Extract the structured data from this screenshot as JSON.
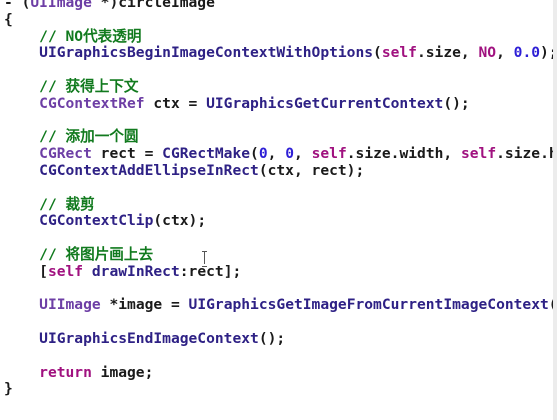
{
  "editor": {
    "lines": [
      [
        {
          "t": "- (",
          "c": "tx"
        },
        {
          "t": "UIImage",
          "c": "ty"
        },
        {
          "t": " *)circleImage",
          "c": "tx"
        }
      ],
      [
        {
          "t": "{",
          "c": "tx"
        }
      ],
      [
        {
          "t": "    ",
          "c": "tx"
        },
        {
          "t": "// NO代表透明",
          "c": "cm"
        }
      ],
      [
        {
          "t": "    ",
          "c": "tx"
        },
        {
          "t": "UIGraphicsBeginImageContextWithOptions",
          "c": "fn"
        },
        {
          "t": "(",
          "c": "tx"
        },
        {
          "t": "self",
          "c": "kw"
        },
        {
          "t": ".size, ",
          "c": "tx"
        },
        {
          "t": "NO",
          "c": "kw"
        },
        {
          "t": ", ",
          "c": "tx"
        },
        {
          "t": "0.0",
          "c": "nu"
        },
        {
          "t": ");",
          "c": "tx"
        }
      ],
      [
        {
          "t": "",
          "c": "tx"
        }
      ],
      [
        {
          "t": "    ",
          "c": "tx"
        },
        {
          "t": "// 获得上下文",
          "c": "cm"
        }
      ],
      [
        {
          "t": "    ",
          "c": "tx"
        },
        {
          "t": "CGContextRef",
          "c": "ty"
        },
        {
          "t": " ctx = ",
          "c": "tx"
        },
        {
          "t": "UIGraphicsGetCurrentContext",
          "c": "fn"
        },
        {
          "t": "();",
          "c": "tx"
        }
      ],
      [
        {
          "t": "",
          "c": "tx"
        }
      ],
      [
        {
          "t": "    ",
          "c": "tx"
        },
        {
          "t": "// 添加一个圆",
          "c": "cm"
        }
      ],
      [
        {
          "t": "    ",
          "c": "tx"
        },
        {
          "t": "CGRect",
          "c": "ty"
        },
        {
          "t": " rect = ",
          "c": "tx"
        },
        {
          "t": "CGRectMake",
          "c": "fn"
        },
        {
          "t": "(",
          "c": "tx"
        },
        {
          "t": "0",
          "c": "nu"
        },
        {
          "t": ", ",
          "c": "tx"
        },
        {
          "t": "0",
          "c": "nu"
        },
        {
          "t": ", ",
          "c": "tx"
        },
        {
          "t": "self",
          "c": "kw"
        },
        {
          "t": ".size.width, ",
          "c": "tx"
        },
        {
          "t": "self",
          "c": "kw"
        },
        {
          "t": ".size.height);",
          "c": "tx"
        }
      ],
      [
        {
          "t": "    ",
          "c": "tx"
        },
        {
          "t": "CGContextAddEllipseInRect",
          "c": "fn"
        },
        {
          "t": "(ctx, rect);",
          "c": "tx"
        }
      ],
      [
        {
          "t": "",
          "c": "tx"
        }
      ],
      [
        {
          "t": "    ",
          "c": "tx"
        },
        {
          "t": "// 裁剪",
          "c": "cm"
        }
      ],
      [
        {
          "t": "    ",
          "c": "tx"
        },
        {
          "t": "CGContextClip",
          "c": "fn"
        },
        {
          "t": "(ctx);",
          "c": "tx"
        }
      ],
      [
        {
          "t": "",
          "c": "tx"
        }
      ],
      [
        {
          "t": "    ",
          "c": "tx"
        },
        {
          "t": "// 将图片画上去",
          "c": "cm"
        }
      ],
      [
        {
          "t": "    [",
          "c": "tx"
        },
        {
          "t": "self",
          "c": "kw"
        },
        {
          "t": " ",
          "c": "tx"
        },
        {
          "t": "drawInRect",
          "c": "fn"
        },
        {
          "t": ":rect];",
          "c": "tx"
        }
      ],
      [
        {
          "t": "",
          "c": "tx"
        }
      ],
      [
        {
          "t": "    ",
          "c": "tx"
        },
        {
          "t": "UIImage",
          "c": "ty"
        },
        {
          "t": " *image = ",
          "c": "tx"
        },
        {
          "t": "UIGraphicsGetImageFromCurrentImageContext",
          "c": "fn"
        },
        {
          "t": "();",
          "c": "tx"
        }
      ],
      [
        {
          "t": "",
          "c": "tx"
        }
      ],
      [
        {
          "t": "    ",
          "c": "tx"
        },
        {
          "t": "UIGraphicsEndImageContext",
          "c": "fn"
        },
        {
          "t": "();",
          "c": "tx"
        }
      ],
      [
        {
          "t": "",
          "c": "tx"
        }
      ],
      [
        {
          "t": "    ",
          "c": "tx"
        },
        {
          "t": "return",
          "c": "kw"
        },
        {
          "t": " image;",
          "c": "tx"
        }
      ],
      [
        {
          "t": "}",
          "c": "tx"
        }
      ]
    ],
    "cursor_icon": "i-beam-cursor-icon"
  }
}
